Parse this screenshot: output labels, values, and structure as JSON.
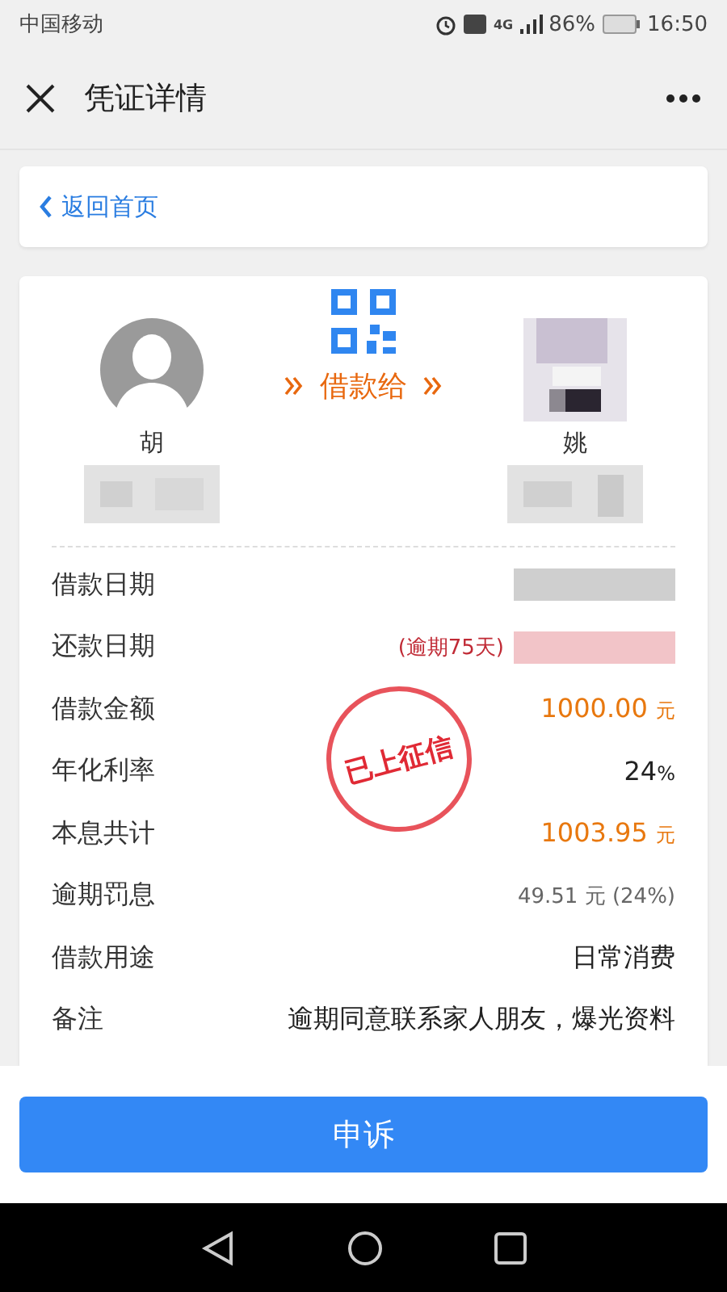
{
  "status_bar": {
    "carrier": "中国移动",
    "network": "4G",
    "battery": "86%",
    "time": "16:50"
  },
  "header": {
    "title": "凭证详情"
  },
  "back_link": {
    "label": "返回首页"
  },
  "transfer": {
    "lender": {
      "name": "胡"
    },
    "action": "借款给",
    "borrower": {
      "name": "姚"
    }
  },
  "stamp": "已上征信",
  "rows": [
    {
      "label": "借款日期",
      "kind": "redacted",
      "color": "#cfcfcf"
    },
    {
      "label": "还款日期",
      "kind": "redacted",
      "color": "#f2c4c8",
      "note": "(逾期75天)"
    },
    {
      "label": "借款金额",
      "kind": "amount",
      "value": "1000.00",
      "unit": "元"
    },
    {
      "label": "年化利率",
      "kind": "plain",
      "value": "24",
      "unit": "%"
    },
    {
      "label": "本息共计",
      "kind": "amount",
      "value": "1003.95",
      "unit": "元"
    },
    {
      "label": "逾期罚息",
      "kind": "muted",
      "value": "49.51 元 (24%)"
    },
    {
      "label": "借款用途",
      "kind": "plain",
      "value": "日常消费"
    },
    {
      "label": "备注",
      "kind": "plain",
      "value": "逾期同意联系家人朋友，爆光资料"
    }
  ],
  "appeal_button": "申诉"
}
